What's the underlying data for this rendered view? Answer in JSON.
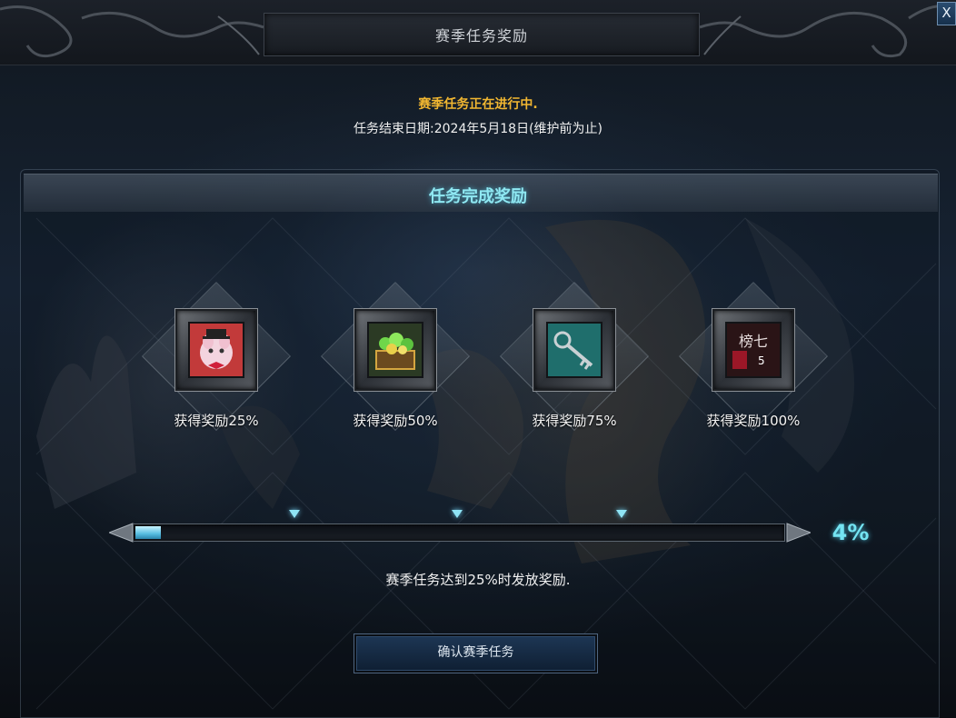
{
  "window": {
    "title": "赛季任务奖励",
    "close_label": "X"
  },
  "status": {
    "message": "赛季任务正在进行中.",
    "end_date": "任务结束日期:2024年5月18日(维护前为止)"
  },
  "panel": {
    "title": "任务完成奖励"
  },
  "rewards": [
    {
      "label": "获得奖励25%",
      "icon": "pink-cat-costume-icon"
    },
    {
      "label": "获得奖励50%",
      "icon": "treasure-chest-icon"
    },
    {
      "label": "获得奖励75%",
      "icon": "key-icon"
    },
    {
      "label": "获得奖励100%",
      "icon": "title-badge-icon",
      "badge_text": "榜七",
      "count": "5"
    }
  ],
  "progress": {
    "value": 0.04,
    "display": "4%",
    "milestones": [
      0.25,
      0.5,
      0.75
    ]
  },
  "hint": "赛季任务达到25%时发放奖励.",
  "confirm_button": "确认赛季任务",
  "colors": {
    "accent_cyan": "#74e4f2",
    "status_gold": "#f2b731",
    "button_blue": "#1d3654"
  }
}
